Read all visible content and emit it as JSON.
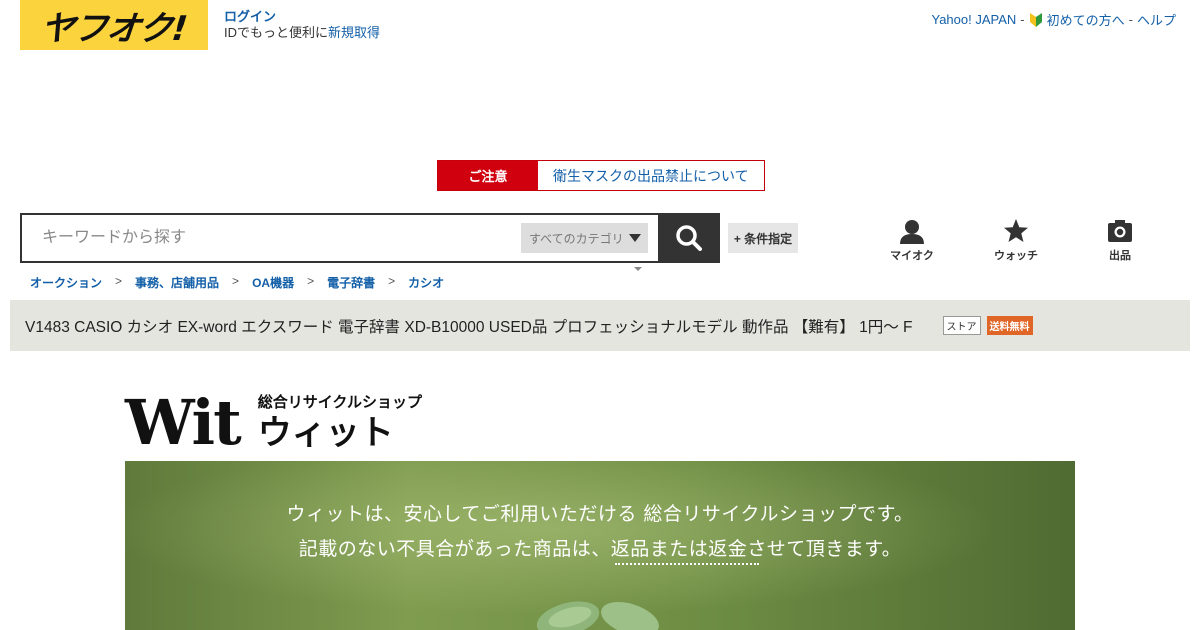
{
  "header": {
    "logo_text": "ヤフオク!",
    "login_label": "ログイン",
    "login_sub": "IDでもっと便利に",
    "signup_label": "新規取得",
    "links": [
      "Yahoo! JAPAN",
      "初めての方へ",
      "ヘルプ"
    ],
    "separator": "-"
  },
  "notice": {
    "tag": "ご注意",
    "link": "衛生マスクの出品禁止について"
  },
  "search": {
    "placeholder": "キーワードから探す",
    "category": "すべてのカテゴリ",
    "condition_label": "+ 条件指定"
  },
  "tools": [
    {
      "label": "マイオク",
      "icon": "user-icon"
    },
    {
      "label": "ウォッチ",
      "icon": "star-icon"
    },
    {
      "label": "出品",
      "icon": "camera-icon"
    }
  ],
  "breadcrumb": {
    "items": [
      "オークション",
      "事務、店舗用品",
      "OA機器",
      "電子辞書",
      "カシオ"
    ],
    "separator": ">"
  },
  "item": {
    "title": "V1483 CASIO カシオ EX-word エクスワード 電子辞書 XD-B10000 USED品 プロフェッショナルモデル 動作品 【難有】 1円～ F",
    "store_badge": "ストア",
    "shipping_badge": "送料無料"
  },
  "shop": {
    "logo_big": "Wit",
    "logo_sub": "総合リサイクルショップ",
    "logo_kana": "ウィット",
    "banner_line1": "ウィットは、安心してご利用いただける 総合リサイクルショップです。",
    "banner_line2": "記載のない不具合があった商品は、返品または返金させて頂きます。"
  },
  "colors": {
    "brand_yellow": "#fbd43d",
    "link_blue": "#135fa8",
    "notice_red": "#d1000e",
    "shipping_orange": "#e06627"
  }
}
